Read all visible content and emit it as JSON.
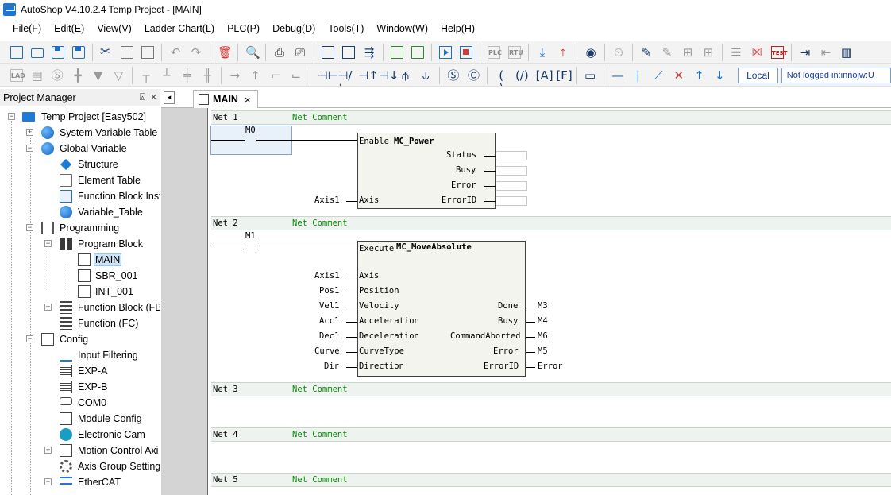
{
  "window": {
    "title": "AutoShop V4.10.2.4  Temp Project - [MAIN]"
  },
  "menu": [
    "File(F)",
    "Edit(E)",
    "View(V)",
    "Ladder Chart(L)",
    "PLC(P)",
    "Debug(D)",
    "Tools(T)",
    "Window(W)",
    "Help(H)"
  ],
  "toolbar1": {
    "plc_label": "PLC",
    "rtu_label": "RTU",
    "test_label": "TEST"
  },
  "toolbar2": {
    "local_label": "Local",
    "login_status": "Not logged in:innojw:U"
  },
  "project_manager": {
    "title": "Project Manager",
    "pin_glyph": "⍓",
    "close_glyph": "×",
    "nodes": [
      {
        "label": "Temp Project [Easy502]",
        "icon": "pc-icon"
      },
      {
        "label": "System Variable Table",
        "icon": "globe-icon"
      },
      {
        "label": "Global Variable",
        "icon": "globe-icon"
      },
      {
        "label": "Structure",
        "icon": "diamond-icon"
      },
      {
        "label": "Element Table",
        "icon": "table-icon"
      },
      {
        "label": "Function Block Inst",
        "icon": "cube-icon"
      },
      {
        "label": "Variable_Table",
        "icon": "globe-icon"
      },
      {
        "label": "Programming",
        "icon": "ladder-icon"
      },
      {
        "label": "Program Block",
        "icon": "grid-icon"
      },
      {
        "label": "MAIN",
        "icon": "page-icon"
      },
      {
        "label": "SBR_001",
        "icon": "page-icon"
      },
      {
        "label": "INT_001",
        "icon": "page-icon"
      },
      {
        "label": "Function Block (FB)",
        "icon": "bars-icon"
      },
      {
        "label": "Function (FC)",
        "icon": "bars-icon"
      },
      {
        "label": "Config",
        "icon": "config-icon"
      },
      {
        "label": "Input Filtering",
        "icon": "wave-icon"
      },
      {
        "label": "EXP-A",
        "icon": "card-icon"
      },
      {
        "label": "EXP-B",
        "icon": "card-icon"
      },
      {
        "label": "COM0",
        "icon": "com-icon"
      },
      {
        "label": "Module Config",
        "icon": "module-icon"
      },
      {
        "label": "Electronic Cam",
        "icon": "cam-icon"
      },
      {
        "label": "Motion Control Axi",
        "icon": "motion-icon"
      },
      {
        "label": "Axis Group Settings",
        "icon": "gear-icon"
      },
      {
        "label": "EtherCAT",
        "icon": "ethercat-icon"
      }
    ]
  },
  "editor": {
    "tab_label": "MAIN",
    "tab_close": "×",
    "tab_nav": "◂",
    "nets": [
      {
        "label": "Net 1",
        "comment": "Net Comment"
      },
      {
        "label": "Net 2",
        "comment": "Net Comment"
      },
      {
        "label": "Net 3",
        "comment": "Net Comment"
      },
      {
        "label": "Net 4",
        "comment": "Net Comment"
      },
      {
        "label": "Net 5",
        "comment": "Net Comment"
      }
    ],
    "net1": {
      "contact": "M0",
      "fb_name": "MC_Power",
      "enable_pin": "Enable",
      "in_pins": [
        {
          "var": "Axis1",
          "pin": "Axis"
        }
      ],
      "out_pins": [
        "Status",
        "Busy",
        "Error",
        "ErrorID"
      ]
    },
    "net2": {
      "contact": "M1",
      "fb_name": "MC_MoveAbsolute",
      "enable_pin": "Execute",
      "in_pins": [
        {
          "var": "Axis1",
          "pin": "Axis"
        },
        {
          "var": "Pos1",
          "pin": "Position"
        },
        {
          "var": "Vel1",
          "pin": "Velocity"
        },
        {
          "var": "Acc1",
          "pin": "Acceleration"
        },
        {
          "var": "Dec1",
          "pin": "Deceleration"
        },
        {
          "var": "Curve",
          "pin": "CurveType"
        },
        {
          "var": "Dir",
          "pin": "Direction"
        }
      ],
      "out_pins": [
        {
          "pin": "Done",
          "var": "M3"
        },
        {
          "pin": "Busy",
          "var": "M4"
        },
        {
          "pin": "CommandAborted",
          "var": "M6"
        },
        {
          "pin": "Error",
          "var": "M5"
        },
        {
          "pin": "ErrorID",
          "var": "Error"
        }
      ]
    }
  }
}
